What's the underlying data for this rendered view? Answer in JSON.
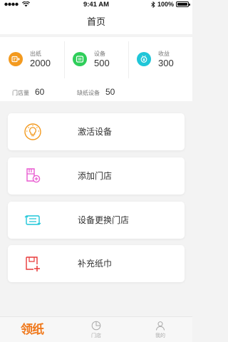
{
  "status_bar": {
    "time": "9:41 AM",
    "battery": "100%",
    "signal_icon": "signal-dots-icon",
    "wifi_icon": "wifi-icon",
    "bluetooth_icon": "bluetooth-icon"
  },
  "nav": {
    "title": "首页"
  },
  "stats": [
    {
      "label": "出纸",
      "value": "2000",
      "icon": "paper-out-icon",
      "color": "#f39a1f"
    },
    {
      "label": "设备",
      "value": "500",
      "icon": "device-icon",
      "color": "#2fce5a"
    },
    {
      "label": "收益",
      "value": "300",
      "icon": "income-icon",
      "color": "#1fc6d8"
    }
  ],
  "sub_stats": {
    "store_label": "门店量",
    "store_value": "60",
    "short_label": "缺纸设备",
    "short_value": "50"
  },
  "actions": [
    {
      "label": "激活设备",
      "icon": "lightbulb-icon",
      "color": "#f39a1f"
    },
    {
      "label": "添加门店",
      "icon": "add-store-icon",
      "color": "#e85ad0"
    },
    {
      "label": "设备更换门店",
      "icon": "swap-device-icon",
      "color": "#1fc6d8"
    },
    {
      "label": "补充纸巾",
      "icon": "refill-tissue-icon",
      "color": "#e83a3a"
    }
  ],
  "tabs": [
    {
      "label": "领纸",
      "icon": "brand-logo-icon",
      "active": true,
      "color": "#f07a1e"
    },
    {
      "label": "门店",
      "icon": "pie-chart-icon",
      "active": false
    },
    {
      "label": "我的",
      "icon": "user-icon",
      "active": false
    }
  ]
}
